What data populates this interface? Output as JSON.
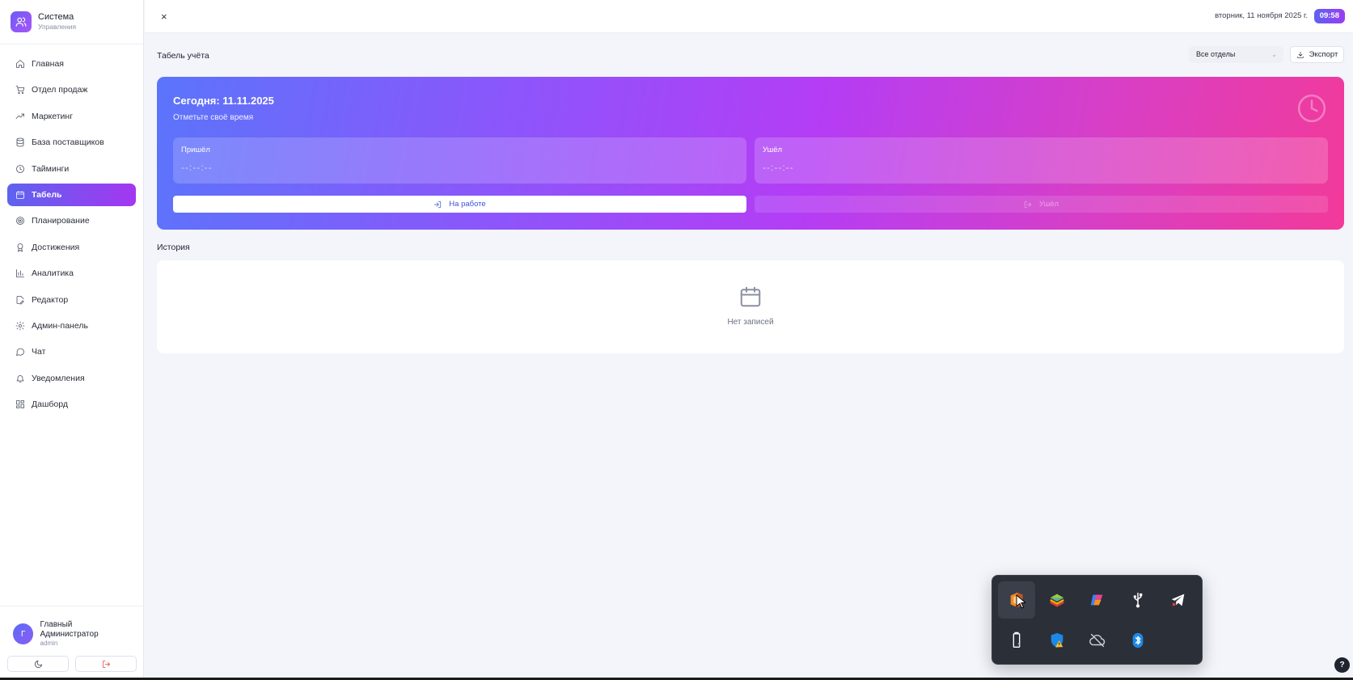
{
  "brand": {
    "title": "Система",
    "subtitle": "Управления",
    "icon": "users-icon",
    "color": "#7c5cf6"
  },
  "sidebar": {
    "items": [
      {
        "label": "Главная",
        "icon": "home-icon",
        "active": false
      },
      {
        "label": "Отдел продаж",
        "icon": "cart-icon",
        "active": false
      },
      {
        "label": "Маркетинг",
        "icon": "trending-up-icon",
        "active": false
      },
      {
        "label": "База поставщиков",
        "icon": "database-icon",
        "active": false
      },
      {
        "label": "Тайминги",
        "icon": "clock-icon",
        "active": false
      },
      {
        "label": "Табель",
        "icon": "calendar-icon",
        "active": true
      },
      {
        "label": "Планирование",
        "icon": "target-icon",
        "active": false
      },
      {
        "label": "Достижения",
        "icon": "award-icon",
        "active": false
      },
      {
        "label": "Аналитика",
        "icon": "bar-chart-icon",
        "active": false
      },
      {
        "label": "Редактор",
        "icon": "file-edit-icon",
        "active": false
      },
      {
        "label": "Админ-панель",
        "icon": "gear-icon",
        "active": false
      },
      {
        "label": "Чат",
        "icon": "chat-icon",
        "active": false
      },
      {
        "label": "Уведомления",
        "icon": "bell-icon",
        "active": false
      },
      {
        "label": "Дашборд",
        "icon": "grid-icon",
        "active": false
      }
    ]
  },
  "user": {
    "initial": "Г",
    "name": "Главный Администратор",
    "role": "admin"
  },
  "topbar": {
    "close_label": "×",
    "date_text": "вторник, 11 ноября 2025 г.",
    "time_badge": "09:58"
  },
  "page": {
    "title": "Табель учёта",
    "department_select": "Все отделы",
    "export_label": "Экспорт"
  },
  "hero": {
    "title": "Сегодня: 11.11.2025",
    "subtitle": "Отметьте своё время",
    "arrived_label": "Пришёл",
    "arrived_value": "--:--:--",
    "left_label": "Ушёл",
    "left_value": "--:--:--",
    "at_work_button": "На работе",
    "left_button": "Ушёл"
  },
  "history": {
    "title": "История",
    "empty_text": "Нет записей"
  },
  "tray": {
    "icons": [
      "office-icon",
      "bluestacks-icon",
      "copilot-icon",
      "usb-icon",
      "telegram-icon",
      "usb-drive-icon",
      "security-warning-icon",
      "cloud-off-icon",
      "bluetooth-icon"
    ]
  },
  "help": {
    "label": "?"
  },
  "colors": {
    "accent_start": "#5b74fb",
    "accent_end": "#f23a9a",
    "active_nav": "#8a4cf0"
  }
}
